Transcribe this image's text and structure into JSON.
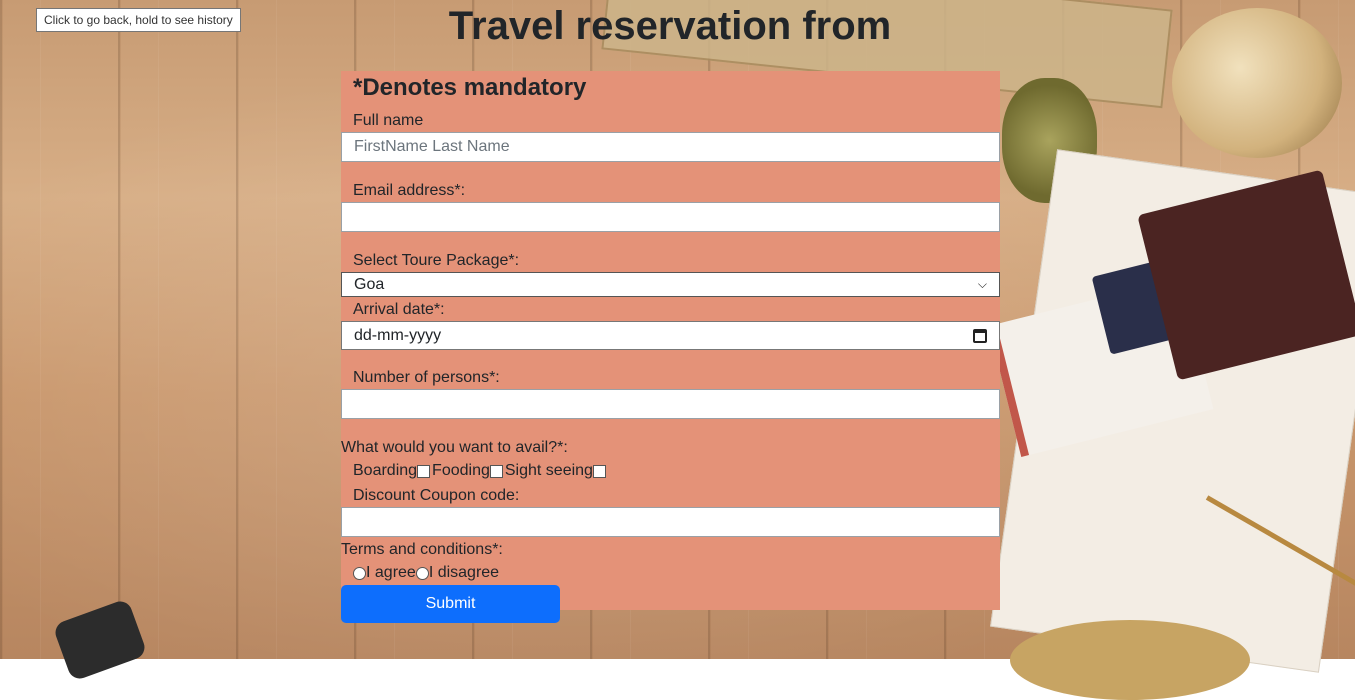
{
  "tooltip": "Click to go back, hold to see history",
  "page_title": "Travel reservation from",
  "form": {
    "heading": "*Denotes mandatory",
    "full_name_label": "Full name",
    "full_name_placeholder": "FirstName Last Name",
    "email_label": "Email address*:",
    "email_value": "",
    "package_label": "Select Toure Package*:",
    "package_selected": "Goa",
    "arrival_label": "Arrival date*:",
    "arrival_value": "dd-mm-yyyy",
    "persons_label": "Number of persons*:",
    "persons_value": "",
    "avail_label": "What would you want to avail?*:",
    "avail_options": [
      "Boarding",
      "Fooding",
      "Sight seeing"
    ],
    "coupon_label": "Discount Coupon code:",
    "coupon_value": "",
    "terms_label": "Terms and conditions*:",
    "terms_options": [
      "I agree",
      "I disagree"
    ],
    "submit_label": "Submit"
  },
  "colors": {
    "form_bg": "#e49278",
    "submit_bg": "#0d6efd"
  }
}
